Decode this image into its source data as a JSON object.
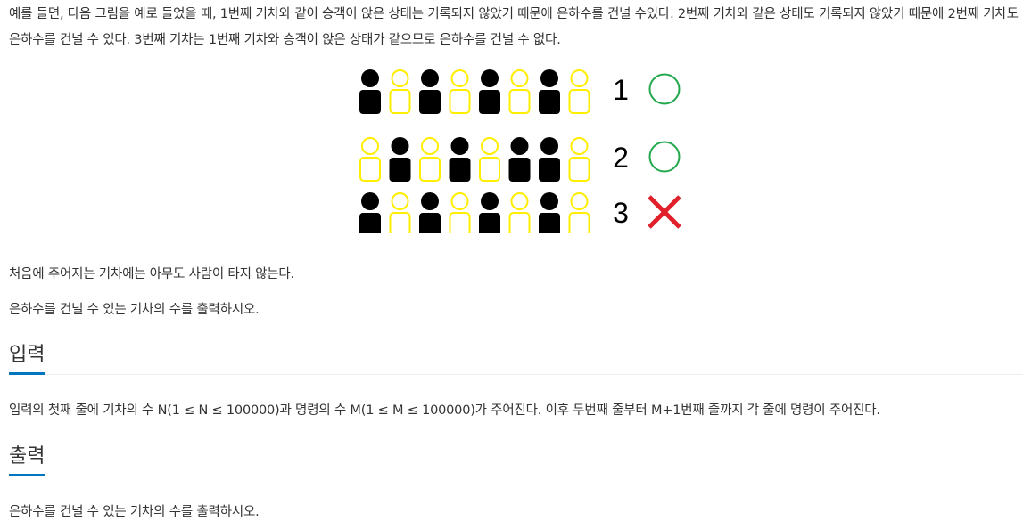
{
  "intro_text": "예를 들면, 다음 그림을 예로 들었을 때, 1번째 기차와 같이 승객이 앉은 상태는 기록되지 않았기 때문에 은하수를 건널 수있다. 2번째 기차와 같은 상태도 기록되지 않았기 때문에 2번째 기차도 은하수를 건널 수 있다. 3번째 기차는 1번째 기차와 승객이 앉은 상태가 같으므로 은하수를 건널 수 없다.",
  "figure": {
    "trains": [
      {
        "number": "1",
        "result": "circle",
        "seats": [
          "B",
          "Y",
          "B",
          "Y",
          "B",
          "Y",
          "B",
          "Y"
        ]
      },
      {
        "number": "2",
        "result": "circle",
        "seats": [
          "Y",
          "B",
          "Y",
          "B",
          "Y",
          "B",
          "B",
          "Y"
        ]
      },
      {
        "number": "3",
        "result": "cross",
        "seats": [
          "B",
          "Y",
          "B",
          "Y",
          "B",
          "Y",
          "B",
          "Y"
        ]
      }
    ],
    "colors": {
      "occupied": "#000000",
      "empty_outline": "#ffee00",
      "circle": "#22a84c",
      "cross": "#e0202a"
    }
  },
  "para_start": "처음에 주어지는 기차에는 아무도 사람이 타지 않는다.",
  "para_output_1": "은하수를 건널 수 있는 기차의 수를 출력하시오.",
  "input_heading": "입력",
  "input_text": "입력의 첫째 줄에 기차의 수 N(1 ≤ N ≤ 100000)과 명령의 수 M(1 ≤ M ≤ 100000)가 주어진다. 이후 두번째 줄부터 M+1번째 줄까지 각 줄에 명령이 주어진다.",
  "output_heading": "출력",
  "output_text": "은하수를 건널 수 있는 기차의 수를 출력하시오."
}
